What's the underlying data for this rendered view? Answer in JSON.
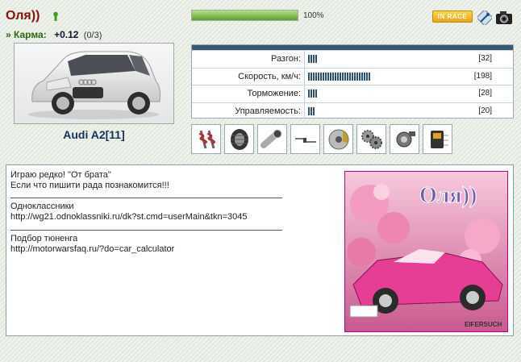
{
  "user": {
    "nickname": "Оля))",
    "karma_label": "» Карма:",
    "karma_value": "+0.12",
    "karma_fraction": "(0/3)"
  },
  "progress": {
    "percent_text": "100%",
    "fraction": 1.0
  },
  "header": {
    "race_button_label": "IN RACE"
  },
  "car": {
    "name": "Audi A2[11]"
  },
  "stats": [
    {
      "label": "Разгон:",
      "value": "[32]",
      "level": 32
    },
    {
      "label": "Скорость, км/ч:",
      "value": "[198]",
      "level": 198
    },
    {
      "label": "Торможение:",
      "value": "[28]",
      "level": 28
    },
    {
      "label": "Управляемость:",
      "value": "[20]",
      "level": 20
    }
  ],
  "parts_icons": [
    "suspension-icon",
    "tire-icon",
    "exhaust-muffler-icon",
    "exhaust-pipe-icon",
    "brake-disc-icon",
    "gears-icon",
    "turbo-icon",
    "ecu-chip-icon"
  ],
  "profile": {
    "line1": "Играю редко! \"От брата\"",
    "line2": "Если что пишити рада познакомится!!!",
    "section1_title": "Одноклассники",
    "section1_link": "http://wg21.odnoklassniki.ru/dk?st.cmd=userMain&tkn=3045",
    "section2_title": "Подбор тюненга",
    "section2_link": "http://motorwarsfaq.ru/?do=car_calculator",
    "image_caption": "Оля))",
    "image_signature": "EIFERSUCH"
  },
  "colors": {
    "nickname": "#8a1010",
    "progress_fill": "#5c9f2f",
    "stat_bar": "#2c4f6a",
    "race_button": "#e9a417"
  }
}
